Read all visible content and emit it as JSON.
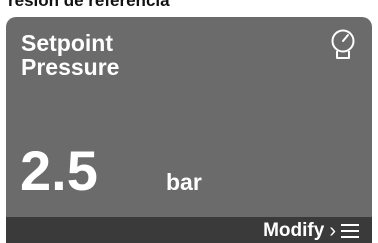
{
  "caption": "resión de referencia",
  "card": {
    "title_line1": "Setpoint",
    "title_line2": "Pressure",
    "value": "2.5",
    "unit": "bar",
    "icon": "gauge-icon",
    "background": "#6b6b6b",
    "footer_background": "#3a3a3a"
  },
  "footer": {
    "modify_label": "Modify",
    "chevron": "›",
    "menu_icon": "hamburger-menu-icon"
  }
}
